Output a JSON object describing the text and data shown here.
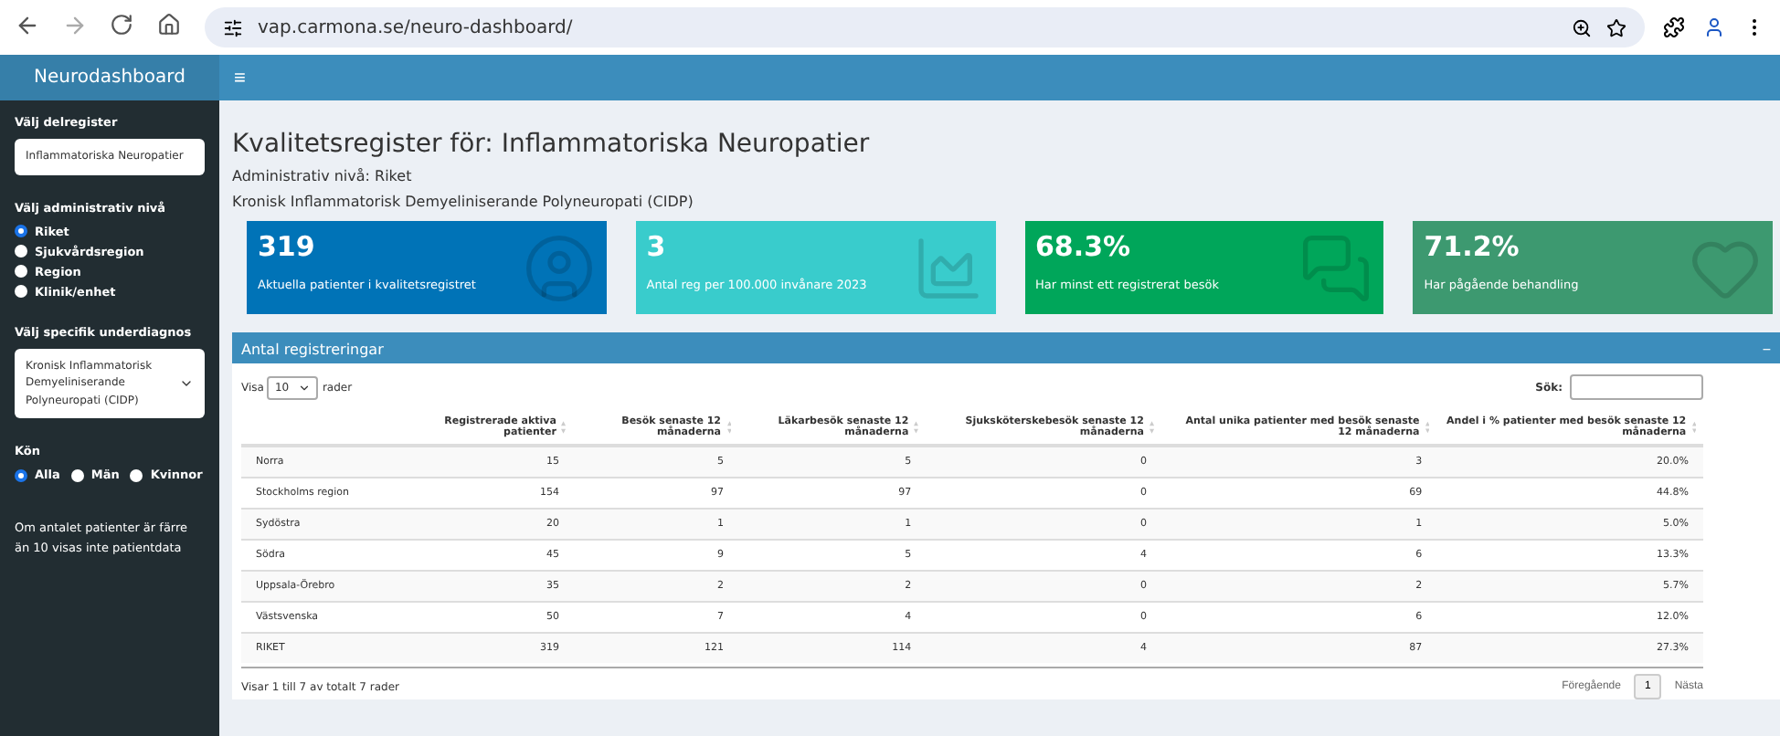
{
  "browser": {
    "url": "vap.carmona.se/neuro-dashboard/"
  },
  "sidebar": {
    "brand": "Neurodashboard",
    "registry": {
      "label": "Välj delregister",
      "value": "Inflammatoriska Neuropatier"
    },
    "level": {
      "label": "Välj administrativ nivå",
      "options": [
        {
          "label": "Riket",
          "selected": true
        },
        {
          "label": "Sjukvårdsregion",
          "selected": false
        },
        {
          "label": "Region",
          "selected": false
        },
        {
          "label": "Klinik/enhet",
          "selected": false
        }
      ]
    },
    "diagnosis": {
      "label": "Välj specifik underdiagnos",
      "value": "Kronisk Inflammatorisk Demyeliniserande Polyneuropati (CIDP)"
    },
    "sex": {
      "label": "Kön",
      "options": [
        {
          "label": "Alla",
          "selected": true
        },
        {
          "label": "Män",
          "selected": false
        },
        {
          "label": "Kvinnor",
          "selected": false
        }
      ]
    },
    "note": "Om antalet patienter är färre än 10 visas inte patientdata"
  },
  "header": {
    "menu": "≡"
  },
  "title": "Kvalitetsregister för: Inflammatoriska Neuropatier",
  "subtitles": [
    "Administrativ nivå: Riket",
    "Kronisk Inflammatorisk Demyeliniserande Polyneuropati (CIDP)"
  ],
  "info_boxes": [
    {
      "value": "319",
      "label": "Aktuella patienter i kvalitetsregistret",
      "color": "#0073b7",
      "kind": "person"
    },
    {
      "value": "3",
      "label": "Antal reg per 100.000 invånare 2023",
      "color": "#39cccc",
      "kind": "chart"
    },
    {
      "value": "68.3%",
      "label": "Har minst ett registrerat besök",
      "color": "#00a65a",
      "kind": "chat"
    },
    {
      "value": "71.2%",
      "label": "Har pågående behandling",
      "color": "#3d9970",
      "kind": "heart"
    }
  ],
  "panel": {
    "title": "Antal registreringar",
    "collapse": "−",
    "show_label": "Visa",
    "show_value": "10",
    "rows_label": "rader",
    "search_label": "Sök:",
    "columns": [
      "",
      "Registrerade aktiva patienter",
      "Besök senaste 12 månaderna",
      "Läkarbesök senaste 12 månaderna",
      "Sjuksköterskebesök senaste 12 månaderna",
      "Antal unika patienter med besök senaste 12 månaderna",
      "Andel i % patienter med besök senaste 12 månaderna"
    ],
    "rows": [
      [
        "Norra",
        "15",
        "5",
        "5",
        "0",
        "3",
        "20.0%"
      ],
      [
        "Stockholms region",
        "154",
        "97",
        "97",
        "0",
        "69",
        "44.8%"
      ],
      [
        "Sydöstra",
        "20",
        "1",
        "1",
        "0",
        "1",
        "5.0%"
      ],
      [
        "Södra",
        "45",
        "9",
        "5",
        "4",
        "6",
        "13.3%"
      ],
      [
        "Uppsala-Örebro",
        "35",
        "2",
        "2",
        "0",
        "2",
        "5.7%"
      ],
      [
        "Västsvenska",
        "50",
        "7",
        "4",
        "0",
        "6",
        "12.0%"
      ],
      [
        "RIKET",
        "319",
        "121",
        "114",
        "4",
        "87",
        "27.3%"
      ]
    ],
    "info": "Visar 1 till 7 av totalt 7 rader",
    "pagination": {
      "previous": "Föregående",
      "page": "1",
      "next": "Nästa"
    }
  }
}
